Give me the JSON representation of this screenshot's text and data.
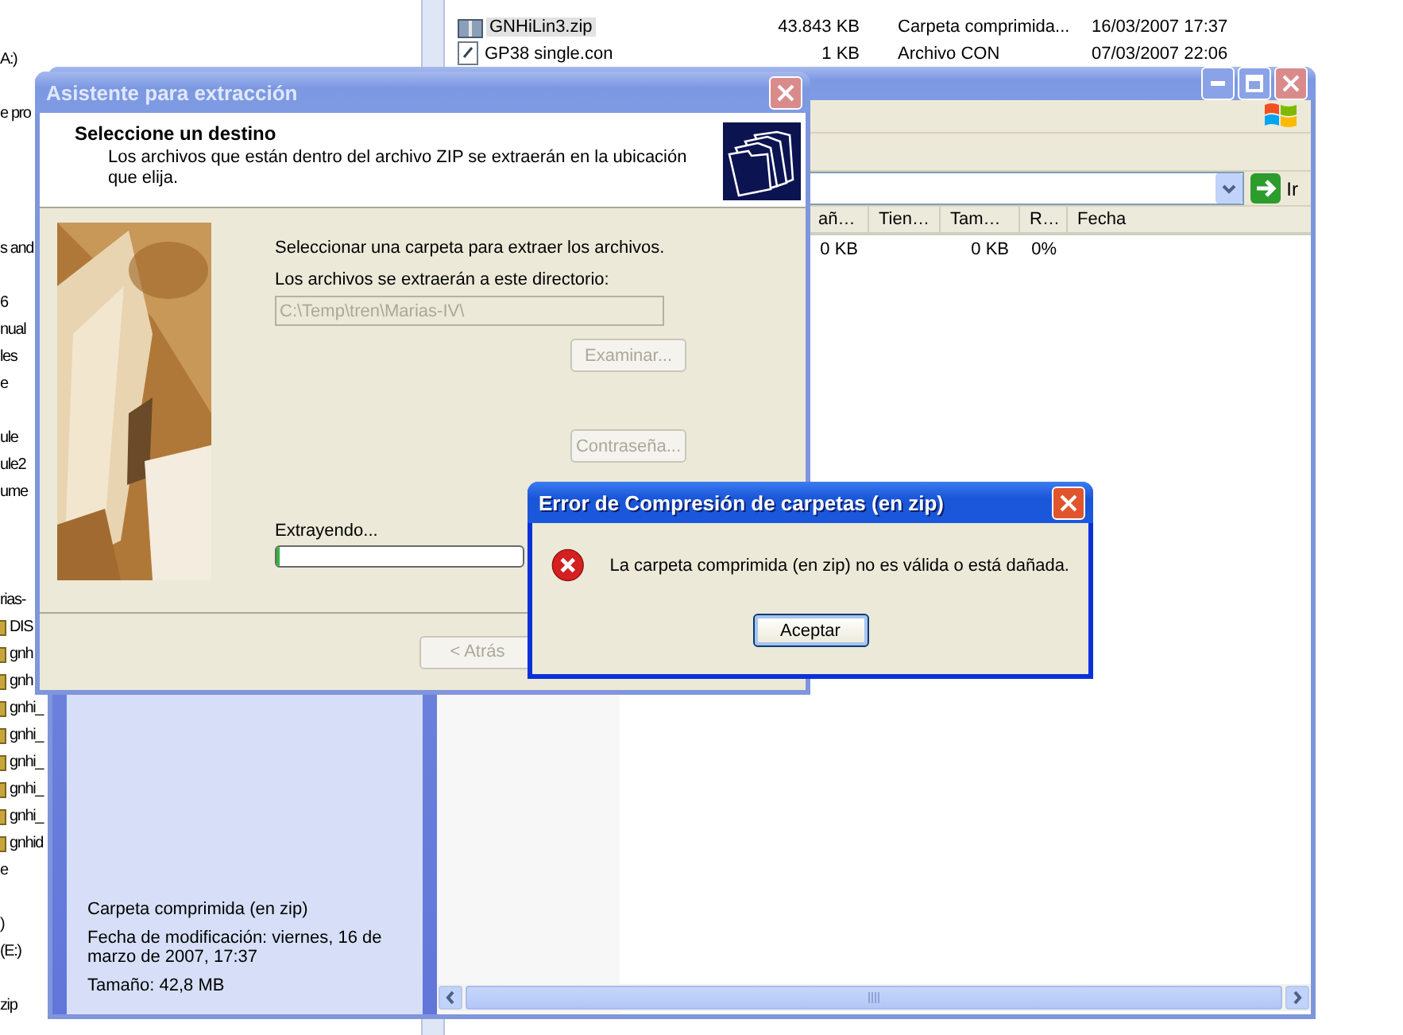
{
  "background_explorer": {
    "tree_fragments": [
      {
        "text": "A:)",
        "kind": "text"
      },
      {
        "text": "e pro",
        "kind": "text"
      },
      {
        "text": "s and",
        "kind": "text"
      },
      {
        "text": "6",
        "kind": "text"
      },
      {
        "text": "nual",
        "kind": "text"
      },
      {
        "text": "les",
        "kind": "text"
      },
      {
        "text": "e",
        "kind": "text"
      },
      {
        "text": "ule",
        "kind": "text"
      },
      {
        "text": "ule2",
        "kind": "text"
      },
      {
        "text": "ume",
        "kind": "text"
      },
      {
        "text": "rias-",
        "kind": "text"
      },
      {
        "text": "DIS",
        "kind": "file"
      },
      {
        "text": "gnh",
        "kind": "file"
      },
      {
        "text": "gnh",
        "kind": "file"
      },
      {
        "text": "gnhi_",
        "kind": "file"
      },
      {
        "text": "gnhi_",
        "kind": "file"
      },
      {
        "text": "gnhi_",
        "kind": "file"
      },
      {
        "text": "gnhi_",
        "kind": "file"
      },
      {
        "text": "gnhi_",
        "kind": "file"
      },
      {
        "text": "gnhid",
        "kind": "file"
      },
      {
        "text": "e",
        "kind": "text"
      },
      {
        "text": ")",
        "kind": "text"
      },
      {
        "text": "(E:)",
        "kind": "text"
      },
      {
        "text": "zip",
        "kind": "text"
      }
    ],
    "files": [
      {
        "name": "GNHiLin3.zip",
        "size": "43.843 KB",
        "type": "Carpeta comprimida...",
        "date": "16/03/2007 17:37",
        "kind": "zip",
        "selected": true
      },
      {
        "name": "GP38 single.con",
        "size": "1 KB",
        "type": "Archivo CON",
        "date": "07/03/2007 22:06",
        "kind": "doc",
        "selected": false
      }
    ]
  },
  "explorer": {
    "go_label": "Ir",
    "columns": [
      "añ…",
      "Tien…",
      "Tam…",
      "R…",
      "Fecha"
    ],
    "rows": [
      {
        "column_1": "0 KB",
        "column_3": "0 KB",
        "column_4": "0%"
      }
    ],
    "details": {
      "type": "Carpeta comprimida (en zip)",
      "modified": "Fecha de modificación: viernes, 16 de marzo de 2007, 17:37",
      "size": "Tamaño: 42,8 MB"
    }
  },
  "wizard": {
    "title": "Asistente para extracción",
    "heading": "Seleccione un destino",
    "description": "Los archivos que están dentro del archivo ZIP se extraerán en la ubicación que elija.",
    "prompt": "Seleccionar una carpeta para extraer los archivos.",
    "dir_label": "Los archivos se extraerán a este directorio:",
    "dir_value": "C:\\Temp\\tren\\Marias-IV\\",
    "browse": {
      "label": "Examinar...",
      "disabled": true
    },
    "password": {
      "label": "Contraseña...",
      "disabled": true
    },
    "progress_label": "Extrayendo...",
    "progress": {
      "level": 0
    },
    "back": {
      "label": "< Atrás",
      "disabled": true
    }
  },
  "error": {
    "title": "Error de Compresión de carpetas (en zip)",
    "message": "La carpeta comprimida (en zip) no es válida o está dañada.",
    "ok": "Aceptar"
  }
}
